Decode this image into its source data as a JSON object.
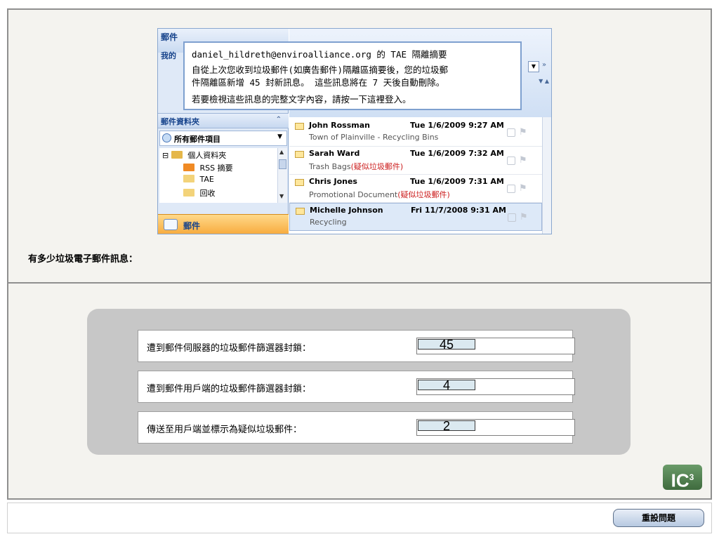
{
  "question": {
    "prompt": "有多少垃圾電子郵件訊息："
  },
  "outlook": {
    "nav_header": "郵件",
    "nav_my": "我的",
    "folder_section_label": "郵件資料夾",
    "all_items_label": "所有郵件項目",
    "tree": [
      {
        "label": "個人資料夾",
        "icon": "personal-folders-icon"
      },
      {
        "label": "RSS 摘要",
        "icon": "rss-icon"
      },
      {
        "label": "TAE",
        "icon": "folder-icon"
      },
      {
        "label": "回收",
        "icon": "folder-icon"
      }
    ],
    "mail_button_label": "郵件",
    "emails": [
      {
        "sender": "John Rossman",
        "date": "Tue 1/6/2009 9:27 AM",
        "subject": "Town of Plainville - Recycling Bins",
        "tag": ""
      },
      {
        "sender": "Sarah Ward",
        "date": "Tue 1/6/2009 7:32 AM",
        "subject": "Trash Bags",
        "tag": "(疑似垃圾郵件)"
      },
      {
        "sender": "Chris Jones",
        "date": "Tue 1/6/2009 7:31 AM",
        "subject": "Promotional Document",
        "tag": "(疑似垃圾郵件)"
      },
      {
        "sender": "Michelle Johnson",
        "date": "Fri 11/7/2008 9:31 AM",
        "subject": "Recycling",
        "tag": ""
      }
    ],
    "popup": {
      "line1": "daniel_hildreth@enviroalliance.org 的 TAE 隔離摘要",
      "line2": "自從上次您收到垃圾郵件(如廣告郵件)隔離區摘要後，您的垃圾郵",
      "line3": "件隔離區新增 45 封新訊息。  這些訊息將在 7 天後自動刪除。",
      "line4": "若要檢視這些訊息的完整文字內容，請按一下這裡登入。"
    }
  },
  "answers": [
    {
      "label": "遭到郵件伺服器的垃圾郵件篩選器封鎖：",
      "value": "45"
    },
    {
      "label": "遭到郵件用戶端的垃圾郵件篩選器封鎖：",
      "value": "4"
    },
    {
      "label": "傳送至用戶端並標示為疑似垃圾郵件：",
      "value": "2"
    }
  ],
  "logo": {
    "text": "IC",
    "superscript": "3"
  },
  "footer": {
    "reset_label": "重設問題"
  },
  "colors": {
    "panel_bg": "#f4f3ef",
    "answer_card_bg": "#c7c7c7",
    "value_field_bg": "#dbe9f0",
    "spam_tag": "#cc1d1d",
    "mail_button": "#f7a93a",
    "logo_green": "#4f7f4e"
  }
}
